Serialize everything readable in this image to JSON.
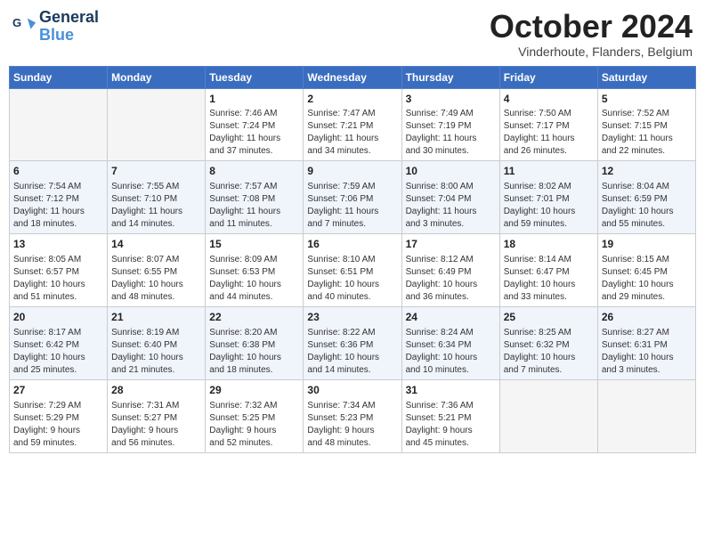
{
  "header": {
    "logo_line1": "General",
    "logo_line2": "Blue",
    "month": "October 2024",
    "location": "Vinderhoute, Flanders, Belgium"
  },
  "days_of_week": [
    "Sunday",
    "Monday",
    "Tuesday",
    "Wednesday",
    "Thursday",
    "Friday",
    "Saturday"
  ],
  "weeks": [
    [
      {
        "day": "",
        "info": ""
      },
      {
        "day": "",
        "info": ""
      },
      {
        "day": "1",
        "info": "Sunrise: 7:46 AM\nSunset: 7:24 PM\nDaylight: 11 hours\nand 37 minutes."
      },
      {
        "day": "2",
        "info": "Sunrise: 7:47 AM\nSunset: 7:21 PM\nDaylight: 11 hours\nand 34 minutes."
      },
      {
        "day": "3",
        "info": "Sunrise: 7:49 AM\nSunset: 7:19 PM\nDaylight: 11 hours\nand 30 minutes."
      },
      {
        "day": "4",
        "info": "Sunrise: 7:50 AM\nSunset: 7:17 PM\nDaylight: 11 hours\nand 26 minutes."
      },
      {
        "day": "5",
        "info": "Sunrise: 7:52 AM\nSunset: 7:15 PM\nDaylight: 11 hours\nand 22 minutes."
      }
    ],
    [
      {
        "day": "6",
        "info": "Sunrise: 7:54 AM\nSunset: 7:12 PM\nDaylight: 11 hours\nand 18 minutes."
      },
      {
        "day": "7",
        "info": "Sunrise: 7:55 AM\nSunset: 7:10 PM\nDaylight: 11 hours\nand 14 minutes."
      },
      {
        "day": "8",
        "info": "Sunrise: 7:57 AM\nSunset: 7:08 PM\nDaylight: 11 hours\nand 11 minutes."
      },
      {
        "day": "9",
        "info": "Sunrise: 7:59 AM\nSunset: 7:06 PM\nDaylight: 11 hours\nand 7 minutes."
      },
      {
        "day": "10",
        "info": "Sunrise: 8:00 AM\nSunset: 7:04 PM\nDaylight: 11 hours\nand 3 minutes."
      },
      {
        "day": "11",
        "info": "Sunrise: 8:02 AM\nSunset: 7:01 PM\nDaylight: 10 hours\nand 59 minutes."
      },
      {
        "day": "12",
        "info": "Sunrise: 8:04 AM\nSunset: 6:59 PM\nDaylight: 10 hours\nand 55 minutes."
      }
    ],
    [
      {
        "day": "13",
        "info": "Sunrise: 8:05 AM\nSunset: 6:57 PM\nDaylight: 10 hours\nand 51 minutes."
      },
      {
        "day": "14",
        "info": "Sunrise: 8:07 AM\nSunset: 6:55 PM\nDaylight: 10 hours\nand 48 minutes."
      },
      {
        "day": "15",
        "info": "Sunrise: 8:09 AM\nSunset: 6:53 PM\nDaylight: 10 hours\nand 44 minutes."
      },
      {
        "day": "16",
        "info": "Sunrise: 8:10 AM\nSunset: 6:51 PM\nDaylight: 10 hours\nand 40 minutes."
      },
      {
        "day": "17",
        "info": "Sunrise: 8:12 AM\nSunset: 6:49 PM\nDaylight: 10 hours\nand 36 minutes."
      },
      {
        "day": "18",
        "info": "Sunrise: 8:14 AM\nSunset: 6:47 PM\nDaylight: 10 hours\nand 33 minutes."
      },
      {
        "day": "19",
        "info": "Sunrise: 8:15 AM\nSunset: 6:45 PM\nDaylight: 10 hours\nand 29 minutes."
      }
    ],
    [
      {
        "day": "20",
        "info": "Sunrise: 8:17 AM\nSunset: 6:42 PM\nDaylight: 10 hours\nand 25 minutes."
      },
      {
        "day": "21",
        "info": "Sunrise: 8:19 AM\nSunset: 6:40 PM\nDaylight: 10 hours\nand 21 minutes."
      },
      {
        "day": "22",
        "info": "Sunrise: 8:20 AM\nSunset: 6:38 PM\nDaylight: 10 hours\nand 18 minutes."
      },
      {
        "day": "23",
        "info": "Sunrise: 8:22 AM\nSunset: 6:36 PM\nDaylight: 10 hours\nand 14 minutes."
      },
      {
        "day": "24",
        "info": "Sunrise: 8:24 AM\nSunset: 6:34 PM\nDaylight: 10 hours\nand 10 minutes."
      },
      {
        "day": "25",
        "info": "Sunrise: 8:25 AM\nSunset: 6:32 PM\nDaylight: 10 hours\nand 7 minutes."
      },
      {
        "day": "26",
        "info": "Sunrise: 8:27 AM\nSunset: 6:31 PM\nDaylight: 10 hours\nand 3 minutes."
      }
    ],
    [
      {
        "day": "27",
        "info": "Sunrise: 7:29 AM\nSunset: 5:29 PM\nDaylight: 9 hours\nand 59 minutes."
      },
      {
        "day": "28",
        "info": "Sunrise: 7:31 AM\nSunset: 5:27 PM\nDaylight: 9 hours\nand 56 minutes."
      },
      {
        "day": "29",
        "info": "Sunrise: 7:32 AM\nSunset: 5:25 PM\nDaylight: 9 hours\nand 52 minutes."
      },
      {
        "day": "30",
        "info": "Sunrise: 7:34 AM\nSunset: 5:23 PM\nDaylight: 9 hours\nand 48 minutes."
      },
      {
        "day": "31",
        "info": "Sunrise: 7:36 AM\nSunset: 5:21 PM\nDaylight: 9 hours\nand 45 minutes."
      },
      {
        "day": "",
        "info": ""
      },
      {
        "day": "",
        "info": ""
      }
    ]
  ]
}
